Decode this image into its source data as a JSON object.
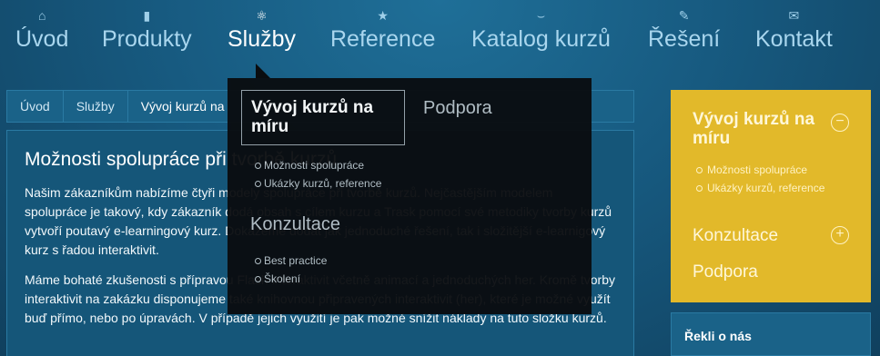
{
  "nav": {
    "items": [
      {
        "label": "Úvod",
        "icon": "home-icon",
        "glyph": "⌂"
      },
      {
        "label": "Produkty",
        "icon": "book-icon",
        "glyph": "▮"
      },
      {
        "label": "Služby",
        "icon": "services-icon",
        "glyph": "⚛"
      },
      {
        "label": "Reference",
        "icon": "star-icon",
        "glyph": "★"
      },
      {
        "label": "Katalog kurzů",
        "icon": "catalog-icon",
        "glyph": "⌣"
      },
      {
        "label": "Řešení",
        "icon": "wrench-icon",
        "glyph": "✎"
      },
      {
        "label": "Kontakt",
        "icon": "envelope-icon",
        "glyph": "✉"
      }
    ],
    "active": "Služby"
  },
  "breadcrumb": [
    "Úvod",
    "Služby",
    "Vývoj kurzů na"
  ],
  "main": {
    "title": "Možnosti spolupráce při tvorbě kurzů",
    "paragraphs": [
      "Našim zákazníkům nabízíme čtyři modely spolupráce při tvorbě kurzů. Nejčastějším modelem spolupráce je takový, kdy zákazník dodá obsah s cílem kurzu a Trask pomocí své metodiky tvorby kurzů vytvoří poutavý e-learningový kurz. Dokážeme dodat jak jednoduché řešení, tak i složitější e-learnigový kurz s řadou interaktivit.",
      "Máme bohaté zkušenosti s přípravou Flash interaktivit včetně animací a jednoduchých her. Kromě tvorby interaktivit na zakázku disponujeme také knihovnou připravených interaktivit (her), které je možné využít buď přímo, nebo po úpravách. V případě jejich využití je pak možné snížit náklady na tuto složku kurzů."
    ]
  },
  "dropdown": {
    "card_title": "Vývoj kurzů na míru",
    "card_items": [
      "Možnosti spolupráce",
      "Ukázky kurzů, reference"
    ],
    "link_support": "Podpora",
    "section2_title": "Konzultace",
    "section2_items": [
      "Best practice",
      "Školení"
    ]
  },
  "sidebar": {
    "title": "Vývoj kurzů na míru",
    "collapse_glyph": "−",
    "items": [
      "Možnosti spolupráce",
      "Ukázky kurzů, reference"
    ],
    "konzultace": "Konzultace",
    "expand_glyph": "+",
    "podpora": "Podpora",
    "panel_color": "#e2b92a"
  },
  "reviews": {
    "title": "Řekli o nás"
  }
}
